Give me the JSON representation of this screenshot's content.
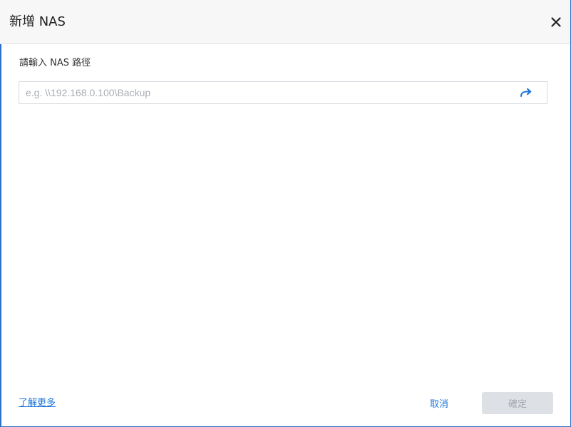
{
  "dialog": {
    "title": "新增 NAS",
    "close_icon": "close-icon"
  },
  "form": {
    "label": "請輸入 NAS 路徑",
    "path_input": {
      "value": "",
      "placeholder": "e.g. \\\\192.168.0.100\\Backup"
    },
    "go_icon": "arrow-redo-icon"
  },
  "footer": {
    "learn_more": "了解更多",
    "cancel_label": "取消",
    "ok_label": "確定",
    "ok_disabled": true
  },
  "colors": {
    "accent": "#1a73d9",
    "disabled_button_bg": "#dde1e6",
    "disabled_button_text": "#a3a8ae",
    "header_bg": "#f7f7f7",
    "window_border": "#2a6fc9"
  }
}
